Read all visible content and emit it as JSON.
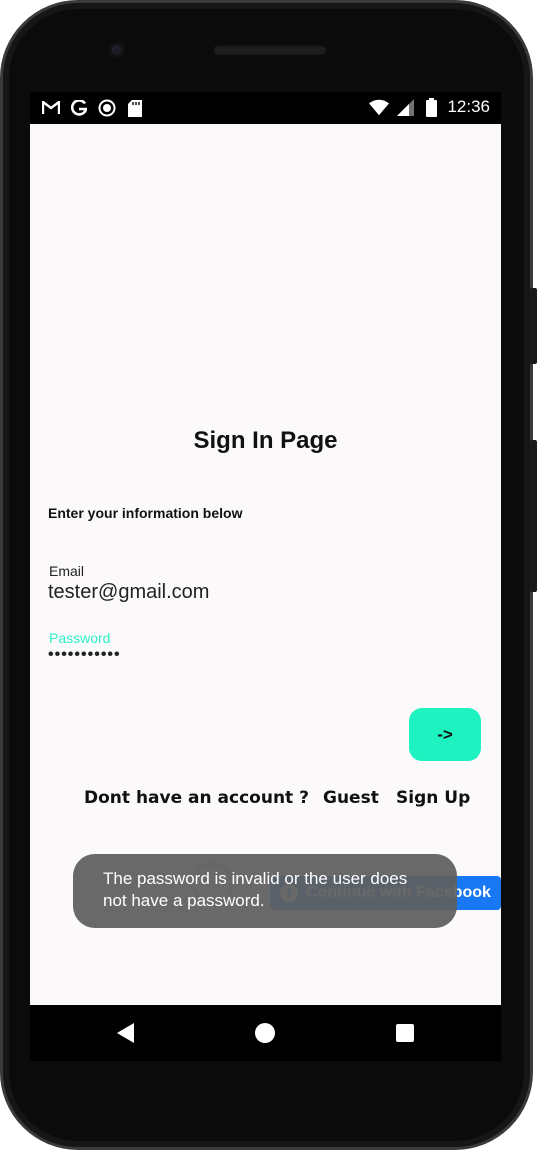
{
  "status_bar": {
    "left_icons": [
      "gmail-icon",
      "google-icon",
      "record-icon",
      "sd-card-icon"
    ],
    "right_icons": [
      "wifi-icon",
      "signal-icon",
      "battery-icon"
    ],
    "time": "12:36"
  },
  "page": {
    "title": "Sign In Page",
    "subtitle": "Enter your information below"
  },
  "email": {
    "label": "Email",
    "value": "tester@gmail.com"
  },
  "password": {
    "label": "Password",
    "value": "•••••••••••",
    "accent_color": "#2ef0c8"
  },
  "submit": {
    "label": "->",
    "color": "#1df2c0"
  },
  "links": {
    "no_account": "Dont have an account ?",
    "guest": "Guest",
    "signup": "Sign Up"
  },
  "social": {
    "facebook_label": "Continue with Facebook",
    "facebook_color": "#1877f2"
  },
  "toast": {
    "message": "The password is invalid or the user does not have a password."
  },
  "nav_bar": {
    "buttons": [
      "back-icon",
      "home-icon",
      "recents-icon"
    ]
  }
}
